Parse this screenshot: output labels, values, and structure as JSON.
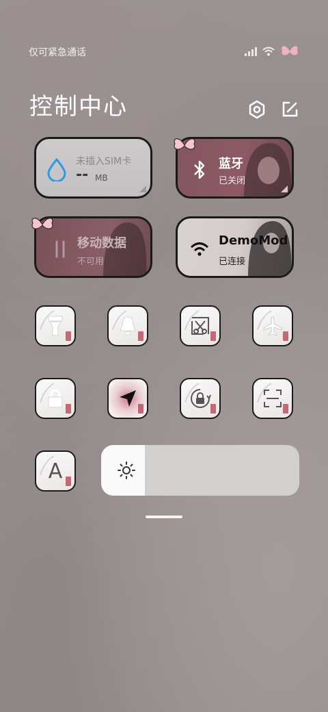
{
  "status_bar": {
    "carrier_text": "仅可紧急通话"
  },
  "header": {
    "title": "控制中心"
  },
  "tiles": {
    "data_usage": {
      "label": "未插入SIM卡",
      "value": "--",
      "unit": "MB"
    },
    "bluetooth": {
      "label": "蓝牙",
      "status": "已关闭"
    },
    "mobile_data": {
      "label": "移动数据",
      "status": "不可用"
    },
    "wifi": {
      "label": "DemoMod",
      "status": "已连接"
    }
  },
  "quick_toggles": [
    {
      "name": "flashlight",
      "icon": "flashlight-icon"
    },
    {
      "name": "mute",
      "icon": "bell-icon"
    },
    {
      "name": "screenshot",
      "icon": "scissors-icon"
    },
    {
      "name": "airplane",
      "icon": "airplane-icon"
    },
    {
      "name": "lock",
      "icon": "lock-icon"
    },
    {
      "name": "location",
      "icon": "location-arrow-icon"
    },
    {
      "name": "rotation",
      "icon": "rotation-lock-icon"
    },
    {
      "name": "scan",
      "icon": "scan-icon"
    },
    {
      "name": "font",
      "icon": "font-icon",
      "label": "A"
    }
  ],
  "brightness": {
    "icon": "sun-icon",
    "level": 0.22
  },
  "colors": {
    "accent_pink": "#8a5661",
    "tile_grey": "#c9c7c7",
    "border": "#1a1a1a",
    "water_blue": "#2b9be8"
  }
}
